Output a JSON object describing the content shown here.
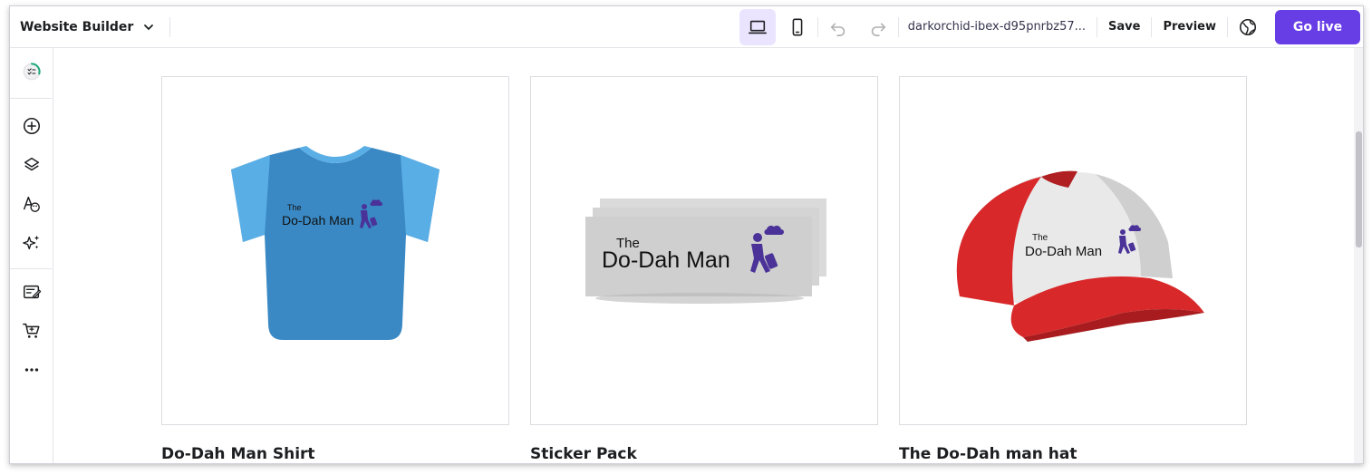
{
  "topbar": {
    "builder_label": "Website Builder",
    "domain": "darkorchid-ibex-d95pnrbz57...",
    "save_label": "Save",
    "preview_label": "Preview",
    "golive_label": "Go live"
  },
  "icons": {
    "device_desktop": "laptop-icon",
    "device_mobile": "mobile-icon",
    "undo": "undo-icon",
    "redo": "redo-icon",
    "publish_globe": "globe-icon"
  },
  "sidebar": {
    "items": [
      {
        "icon": "checklist-progress-icon"
      },
      {
        "icon": "add-section-icon"
      },
      {
        "icon": "layers-icon"
      },
      {
        "icon": "styles-icon"
      },
      {
        "icon": "ai-tools-icon"
      },
      {
        "icon": "blog-icon"
      },
      {
        "icon": "store-cart-icon"
      },
      {
        "icon": "more-icon"
      }
    ]
  },
  "products": [
    {
      "name": "Do-Dah Man Shirt",
      "image": "tshirt"
    },
    {
      "name": "Sticker Pack",
      "image": "stickers"
    },
    {
      "name": "The Do-Dah man hat",
      "image": "cap"
    }
  ],
  "logo": {
    "small": "The",
    "big": "Do-Dah Man"
  },
  "colors": {
    "accent": "#673de6",
    "accent_light": "#ebe4ff",
    "shirt": "#3a89c4",
    "cap_red": "#d8282a",
    "logo_figure": "#5b3ca8"
  }
}
